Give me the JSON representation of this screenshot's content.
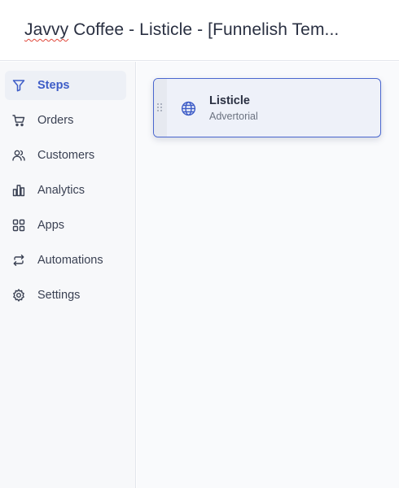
{
  "header": {
    "title_misspelled": "Javvy",
    "title_rest": " Coffee - Listicle - [Funnelish Tem..."
  },
  "sidebar": {
    "items": [
      {
        "label": "Steps",
        "icon": "filter-icon",
        "active": true
      },
      {
        "label": "Orders",
        "icon": "cart-icon",
        "active": false
      },
      {
        "label": "Customers",
        "icon": "users-icon",
        "active": false
      },
      {
        "label": "Analytics",
        "icon": "analytics-icon",
        "active": false
      },
      {
        "label": "Apps",
        "icon": "apps-grid-icon",
        "active": false
      },
      {
        "label": "Automations",
        "icon": "repeat-icon",
        "active": false
      },
      {
        "label": "Settings",
        "icon": "gear-icon",
        "active": false
      }
    ]
  },
  "steps": [
    {
      "title": "Listicle",
      "subtitle": "Advertorial",
      "icon": "globe-icon",
      "selected": true
    }
  ],
  "colors": {
    "accent": "#3d5cc7",
    "card_border": "#4a67cf",
    "spellcheck_underline": "#e0463a"
  }
}
